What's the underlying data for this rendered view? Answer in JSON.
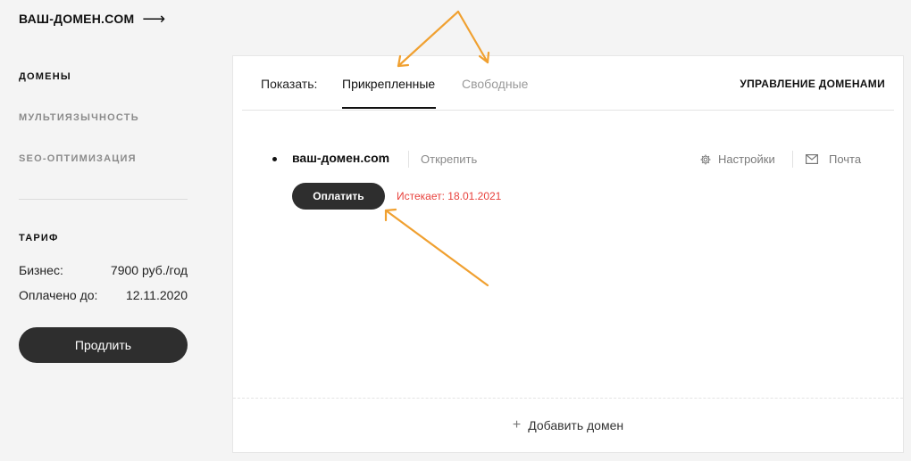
{
  "header": {
    "site_title": "ВАШ-ДОМЕН.COM",
    "arrow_glyph": "⟶"
  },
  "sidebar": {
    "items": [
      {
        "label": "ДОМЕНЫ",
        "active": true
      },
      {
        "label": "МУЛЬТИЯЗЫЧНОСТЬ",
        "active": false
      },
      {
        "label": "SEO-ОПТИМИЗАЦИЯ",
        "active": false
      }
    ],
    "tariff": {
      "heading": "ТАРИФ",
      "rows": [
        {
          "label": "Бизнес:",
          "value": "7900 руб./год"
        },
        {
          "label": "Оплачено до:",
          "value": "12.11.2020"
        }
      ],
      "renew_label": "Продлить"
    }
  },
  "main": {
    "show_label": "Показать:",
    "tabs": [
      {
        "label": "Прикрепленные",
        "selected": true
      },
      {
        "label": "Свободные",
        "selected": false
      }
    ],
    "manage_label": "УПРАВЛЕНИЕ ДОМЕНАМИ",
    "domain": {
      "name": "ваш-домен.com",
      "unpin_label": "Открепить",
      "settings_label": "Настройки",
      "mail_label": "Почта",
      "pay_label": "Оплатить",
      "expires_text": "Истекает: 18.01.2021"
    },
    "add_domain": {
      "plus": "+",
      "label": "Добавить домен"
    }
  },
  "colors": {
    "accent_dark": "#2e2e2e",
    "expires_red": "#e8413c",
    "annotation_orange": "#f0a030",
    "background": "#f4f4f4"
  },
  "icons": [
    "arrow-right-icon",
    "gear-icon",
    "mail-icon",
    "plus-icon"
  ]
}
